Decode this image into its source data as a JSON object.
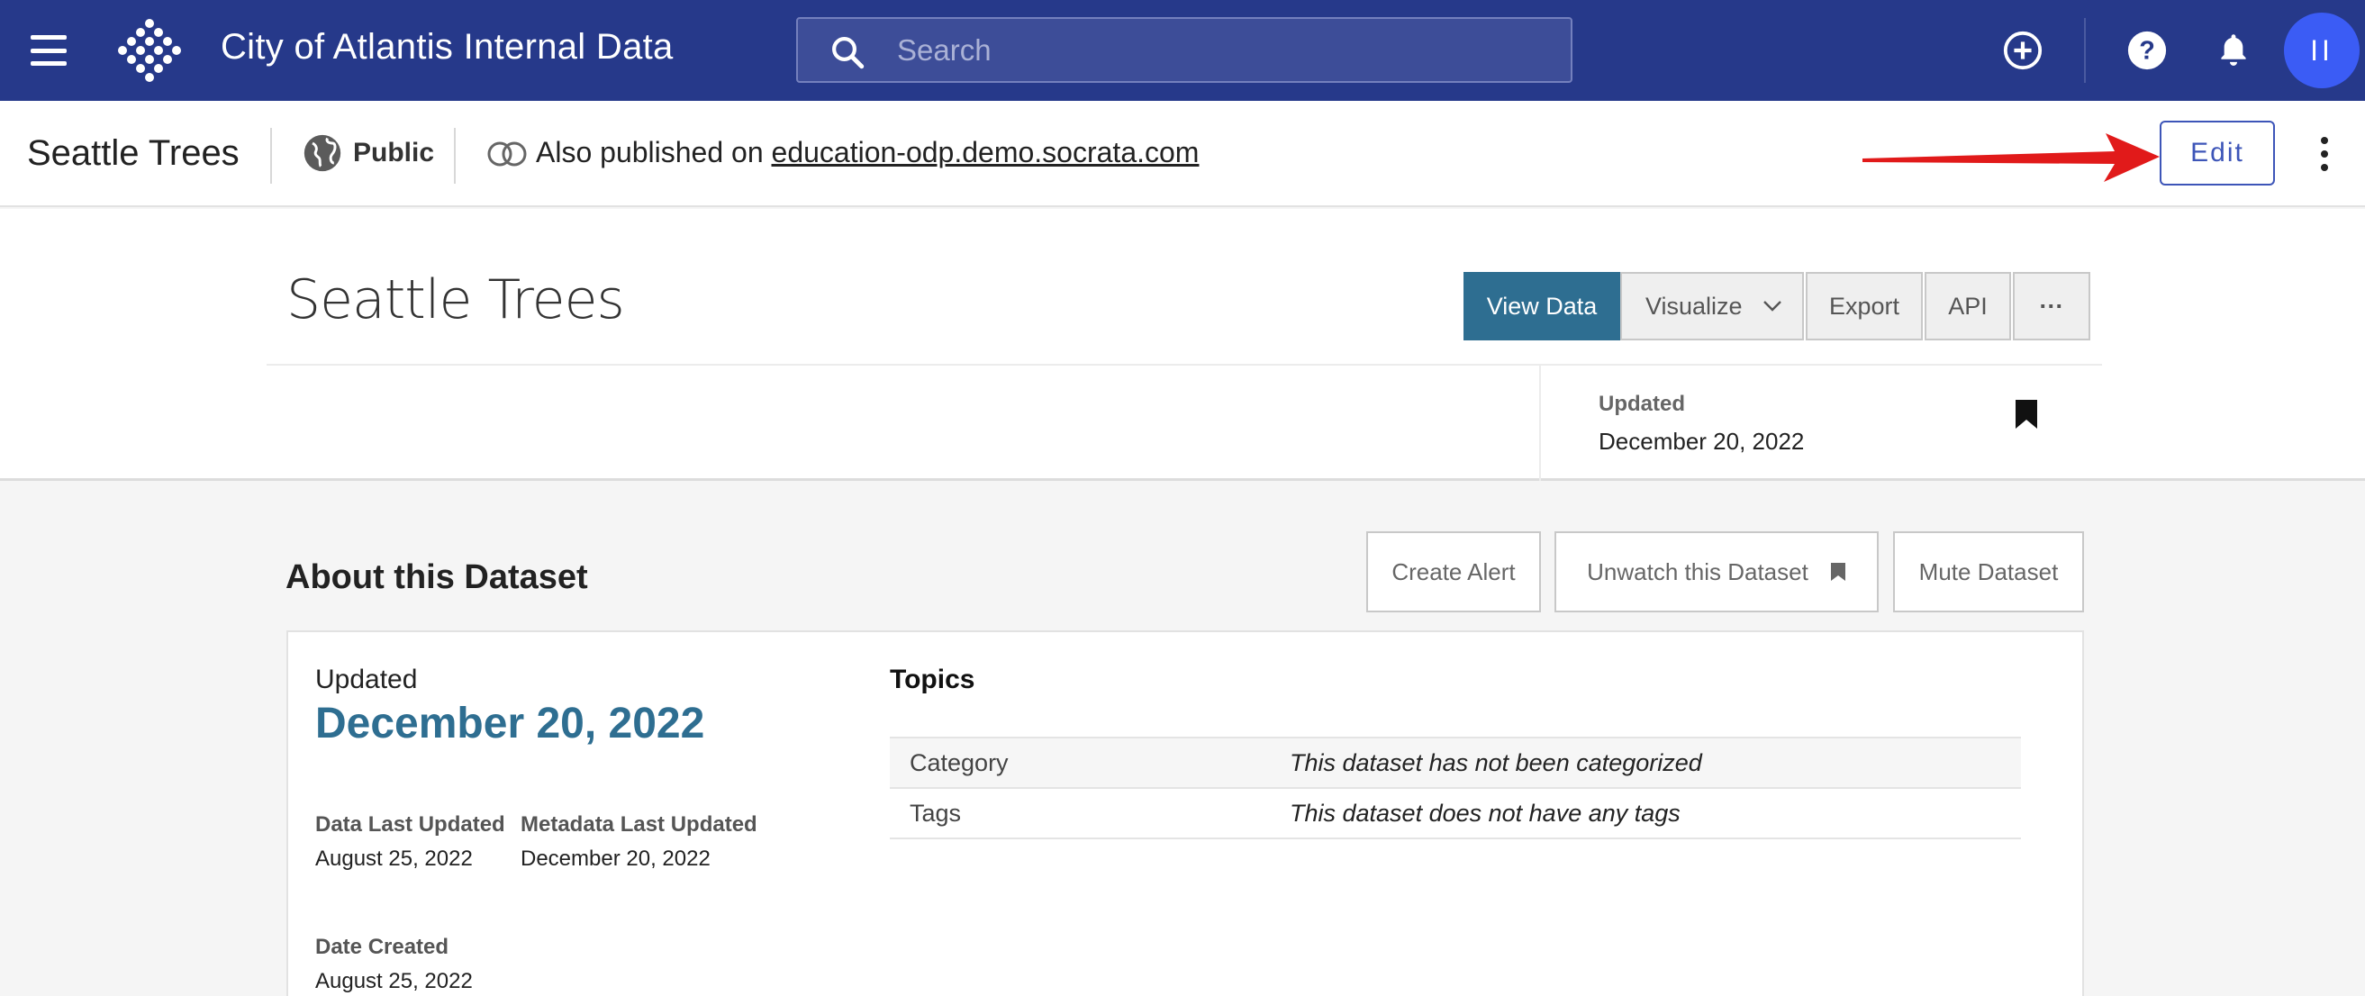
{
  "nav": {
    "title": "City of Atlantis Internal Data",
    "search_placeholder": "Search",
    "avatar_initials": "II",
    "background": "#26398a"
  },
  "subheader": {
    "title": "Seattle Trees",
    "visibility": "Public",
    "also_published_prefix": "Also published on",
    "also_published_link": "education-odp.demo.socrata.com",
    "edit_label": "Edit"
  },
  "dataset": {
    "title": "Seattle Trees",
    "buttons": {
      "view_data": "View Data",
      "visualize": "Visualize",
      "export": "Export",
      "api": "API",
      "more": "···"
    },
    "updated_label": "Updated",
    "updated_value": "December 20, 2022"
  },
  "about": {
    "title": "About this Dataset",
    "create_alert": "Create Alert",
    "unwatch": "Unwatch this Dataset",
    "mute": "Mute Dataset",
    "updated_label": "Updated",
    "updated_date": "December 20, 2022",
    "data_last_updated_label": "Data Last Updated",
    "data_last_updated_value": "August 25, 2022",
    "metadata_last_updated_label": "Metadata Last Updated",
    "metadata_last_updated_value": "December 20, 2022",
    "date_created_label": "Date Created",
    "date_created_value": "August 25, 2022",
    "topics_title": "Topics",
    "topics": [
      {
        "key": "Category",
        "value": "This dataset has not been categorized"
      },
      {
        "key": "Tags",
        "value": "This dataset does not have any tags"
      }
    ]
  },
  "colors": {
    "accent": "#2e6e91",
    "edit": "#3d55b8",
    "arrow": "#e11a1a",
    "avatar": "#3b5cf5"
  }
}
